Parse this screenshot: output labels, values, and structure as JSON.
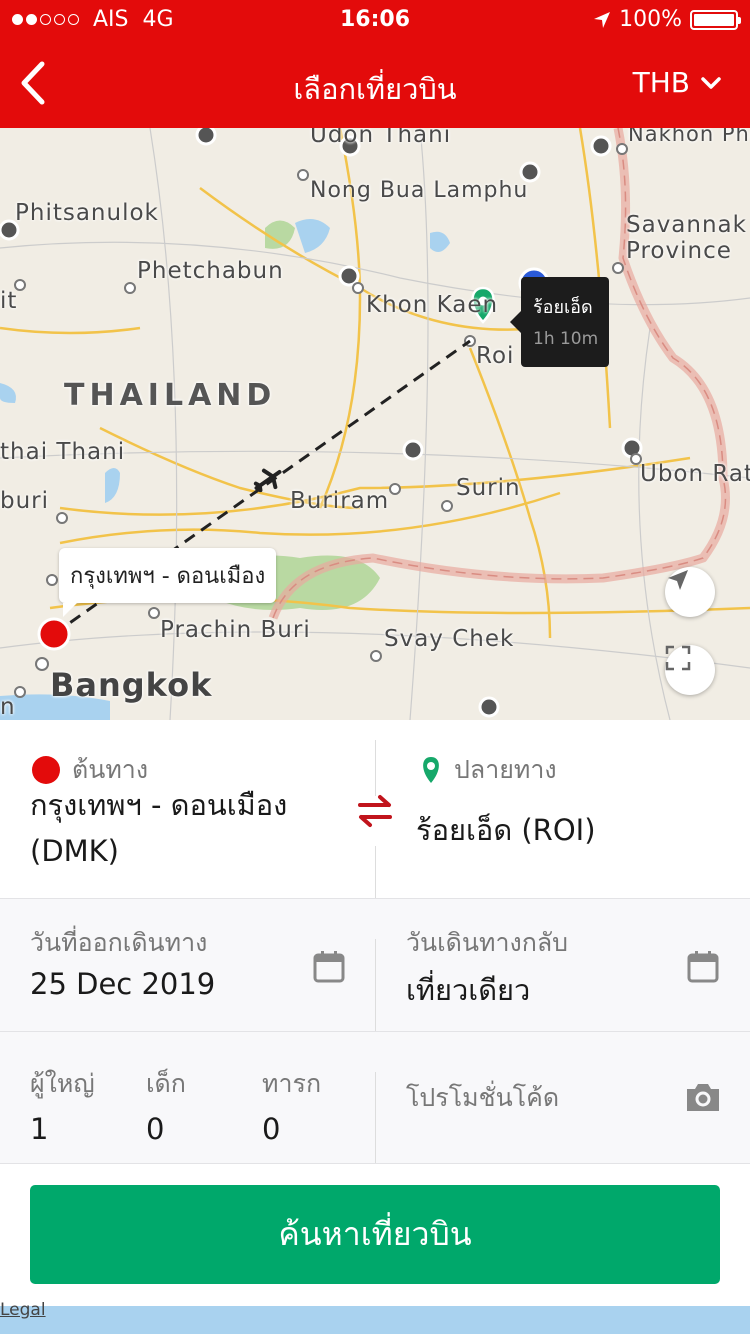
{
  "status": {
    "carrier": "AIS",
    "network": "4G",
    "time": "16:06",
    "battery": "100%",
    "battery_level": 1.0,
    "signal_bars_on": 2,
    "signal_bars_total": 5
  },
  "header": {
    "title": "เลือกเที่ยวบิน",
    "currency": "THB"
  },
  "map": {
    "labels": {
      "udon": "Udon Thani",
      "nakhon": "Nakhon Pho",
      "nongbua": "Nong Bua Lamphu",
      "phitsanulok": "Phitsanulok",
      "savannakhet1": "Savannak",
      "savannakhet2": "Province",
      "phetchabun": "Phetchabun",
      "khonkaen": "Khon Kaen",
      "it": "it",
      "roi": "Roi",
      "thailand": "THAILAND",
      "thaithani": "thai Thani",
      "ubon": "Ubon Rat",
      "buriram": "Buriram",
      "surin": "Surin",
      "buri": "buri",
      "prachin": "Prachin Buri",
      "svay": "Svay Chek",
      "bangkok": "Bangkok",
      "n": "n"
    },
    "origin_callout": "กรุงเทพฯ - ดอนเมือง",
    "dest_callout": {
      "name": "ร้อยเอ็ด",
      "duration": "1h 10m"
    },
    "legal": "Legal",
    "colors": {
      "origin": "#e30b0b",
      "dest": "#16a86a",
      "route": "#222222",
      "road": "#f2c34a",
      "border": "#e8a9a0",
      "water": "#a9d2ef",
      "park": "#b9d9a2"
    }
  },
  "route": {
    "origin_label": "ต้นทาง",
    "origin_value": "กรุงเทพฯ - ดอนเมือง (DMK)",
    "dest_label": "ปลายทาง",
    "dest_value": "ร้อยเอ็ด (ROI)"
  },
  "dates": {
    "depart_label": "วันที่ออกเดินทาง",
    "depart_value": "25 Dec 2019",
    "return_label": "วันเดินทางกลับ",
    "return_value": "เที่ยวเดียว"
  },
  "passengers": {
    "adult_label": "ผู้ใหญ่",
    "adult_value": "1",
    "child_label": "เด็ก",
    "child_value": "0",
    "infant_label": "ทารก",
    "infant_value": "0",
    "promo_label": "โปรโมชั่นโค้ด"
  },
  "search_button": "ค้นหาเที่ยวบิน",
  "icons": [
    "back-chevron-icon",
    "chevron-down-icon",
    "location-arrow-icon",
    "airplane-icon",
    "map-pin-icon",
    "swap-icon",
    "calendar-icon",
    "camera-icon",
    "fullscreen-icon"
  ]
}
